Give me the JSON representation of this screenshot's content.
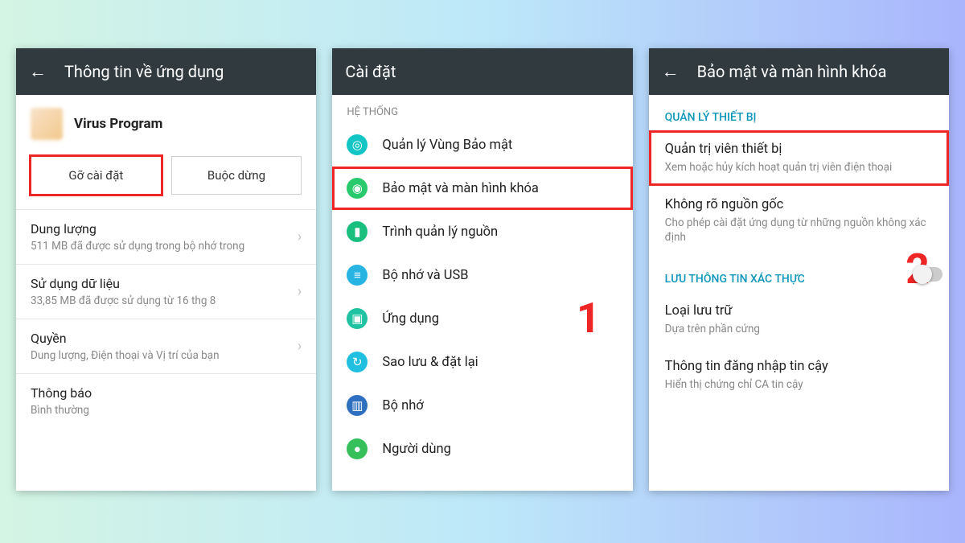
{
  "panel1": {
    "title": "Thông tin về ứng dụng",
    "app_name": "Virus Program",
    "uninstall": "Gỡ cài đặt",
    "force_stop": "Buộc dừng",
    "items": [
      {
        "t1": "Dung lượng",
        "t2": "511 MB đã được sử dụng trong bộ nhớ trong"
      },
      {
        "t1": "Sử dụng dữ liệu",
        "t2": "33,85 MB đã được sử dụng từ 16 thg 8"
      },
      {
        "t1": "Quyền",
        "t2": "Dung lượng, Điện thoại và Vị trí của bạn"
      },
      {
        "t1": "Thông báo",
        "t2": "Bình thường"
      }
    ]
  },
  "panel2": {
    "title": "Cài đặt",
    "section": "HỆ THỐNG",
    "items": [
      {
        "label": "Quản lý Vùng Bảo mật",
        "icon": "shield"
      },
      {
        "label": "Bảo mật và màn hình khóa",
        "icon": "lock",
        "hl": true
      },
      {
        "label": "Trình quản lý nguồn",
        "icon": "battery"
      },
      {
        "label": "Bộ nhớ và USB",
        "icon": "storage"
      },
      {
        "label": "Ứng dụng",
        "icon": "apps"
      },
      {
        "label": "Sao lưu & đặt lại",
        "icon": "backup"
      },
      {
        "label": "Bộ nhớ",
        "icon": "memory"
      },
      {
        "label": "Người dùng",
        "icon": "user"
      }
    ],
    "marker": "1"
  },
  "panel3": {
    "title": "Bảo mật và màn hình khóa",
    "cat1": "QUẢN LÝ THIẾT BỊ",
    "cat2": "LƯU THÔNG TIN XÁC THỰC",
    "items1": [
      {
        "t1": "Quản trị viên thiết bị",
        "t2": "Xem hoặc hủy kích hoạt quản trị viên điện thoại",
        "hl": true
      },
      {
        "t1": "Không rõ nguồn gốc",
        "t2": "Cho phép cài đặt ứng dụng từ những nguồn không xác định"
      }
    ],
    "items2": [
      {
        "t1": "Loại lưu trữ",
        "t2": "Dựa trên phần cứng"
      },
      {
        "t1": "Thông tin đăng nhập tin cậy",
        "t2": "Hiển thị chứng chỉ CA tin cậy"
      }
    ],
    "marker": "2"
  },
  "icons": {
    "shield": "◎",
    "lock": "◉",
    "battery": "▮",
    "storage": "≡",
    "apps": "▣",
    "backup": "↻",
    "memory": "▥",
    "user": "●"
  }
}
